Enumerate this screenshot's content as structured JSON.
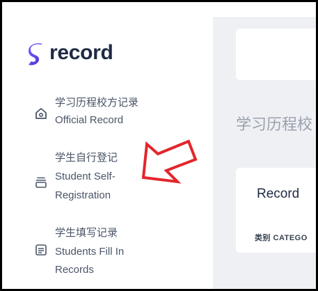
{
  "brand": {
    "name": "record",
    "accent": "#6a4cf5"
  },
  "sidebar": {
    "items": [
      {
        "label_cn": "学习历程校方记录",
        "label_en": [
          "Official Record"
        ],
        "icon": "home-icon"
      },
      {
        "label_cn": "学生自行登记",
        "label_en": [
          "Student Self-",
          "Registration"
        ],
        "icon": "archive-icon"
      },
      {
        "label_cn": "学生填写记录",
        "label_en": [
          "Students Fill In",
          "Records"
        ],
        "icon": "document-icon"
      }
    ]
  },
  "main": {
    "heading": "学习历程校",
    "card": {
      "title": "Record",
      "category_label": "类别 CATEGO"
    }
  },
  "annotation": {
    "arrow_color": "#e3262b",
    "icon": "red-arrow-icon"
  }
}
